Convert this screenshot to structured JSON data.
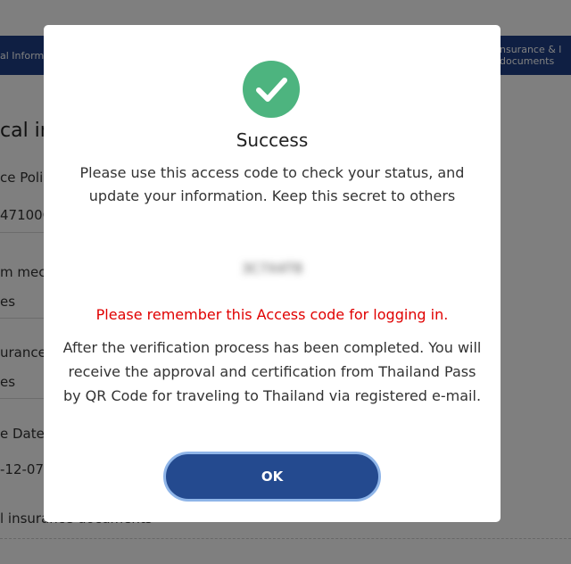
{
  "background": {
    "step_left_label": "al Informa",
    "step_right_label": "nsurance & l documents",
    "heading": "cal in",
    "rows": [
      "ce Poli",
      "47100C",
      "m mec",
      "es",
      "urance",
      "es",
      "e Date",
      "-12-07",
      "l insurance documents"
    ]
  },
  "modal": {
    "icon": "check-circle-icon",
    "title": "Success",
    "message": "Please use this access code to check your status, and update your information. Keep this secret to others",
    "access_code": "3C7X4T8",
    "warning": "Please remember this Access code for logging in.",
    "info": "After the verification process has been completed. You will receive the approval and certification from Thailand Pass by QR Code for traveling to Thailand via registered e-mail.",
    "ok_label": "OK"
  },
  "colors": {
    "primary": "#244a8f",
    "success": "#4db47f",
    "warning": "#e00000",
    "button_border": "#8fb5e8"
  }
}
